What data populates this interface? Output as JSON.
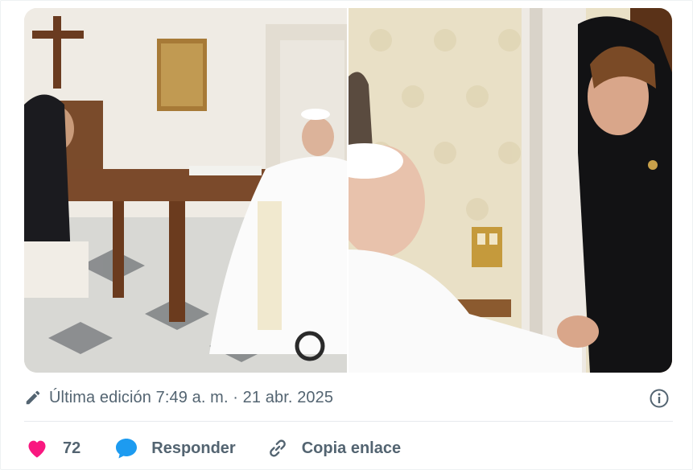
{
  "media": {
    "left_photo_alt": "",
    "right_photo_alt": ""
  },
  "meta": {
    "edited_text": "Última edición 7:49 a. m. · 21 abr. 2025"
  },
  "actions": {
    "like_count": "72",
    "reply_label": "Responder",
    "copy_link_label": "Copia enlace"
  },
  "colors": {
    "heart": "#f91880",
    "reply_bubble": "#1d9bf0",
    "muted_text": "#536471"
  },
  "icons": [
    "pencil-icon",
    "info-icon",
    "heart-icon",
    "reply-bubble-icon",
    "link-icon"
  ]
}
